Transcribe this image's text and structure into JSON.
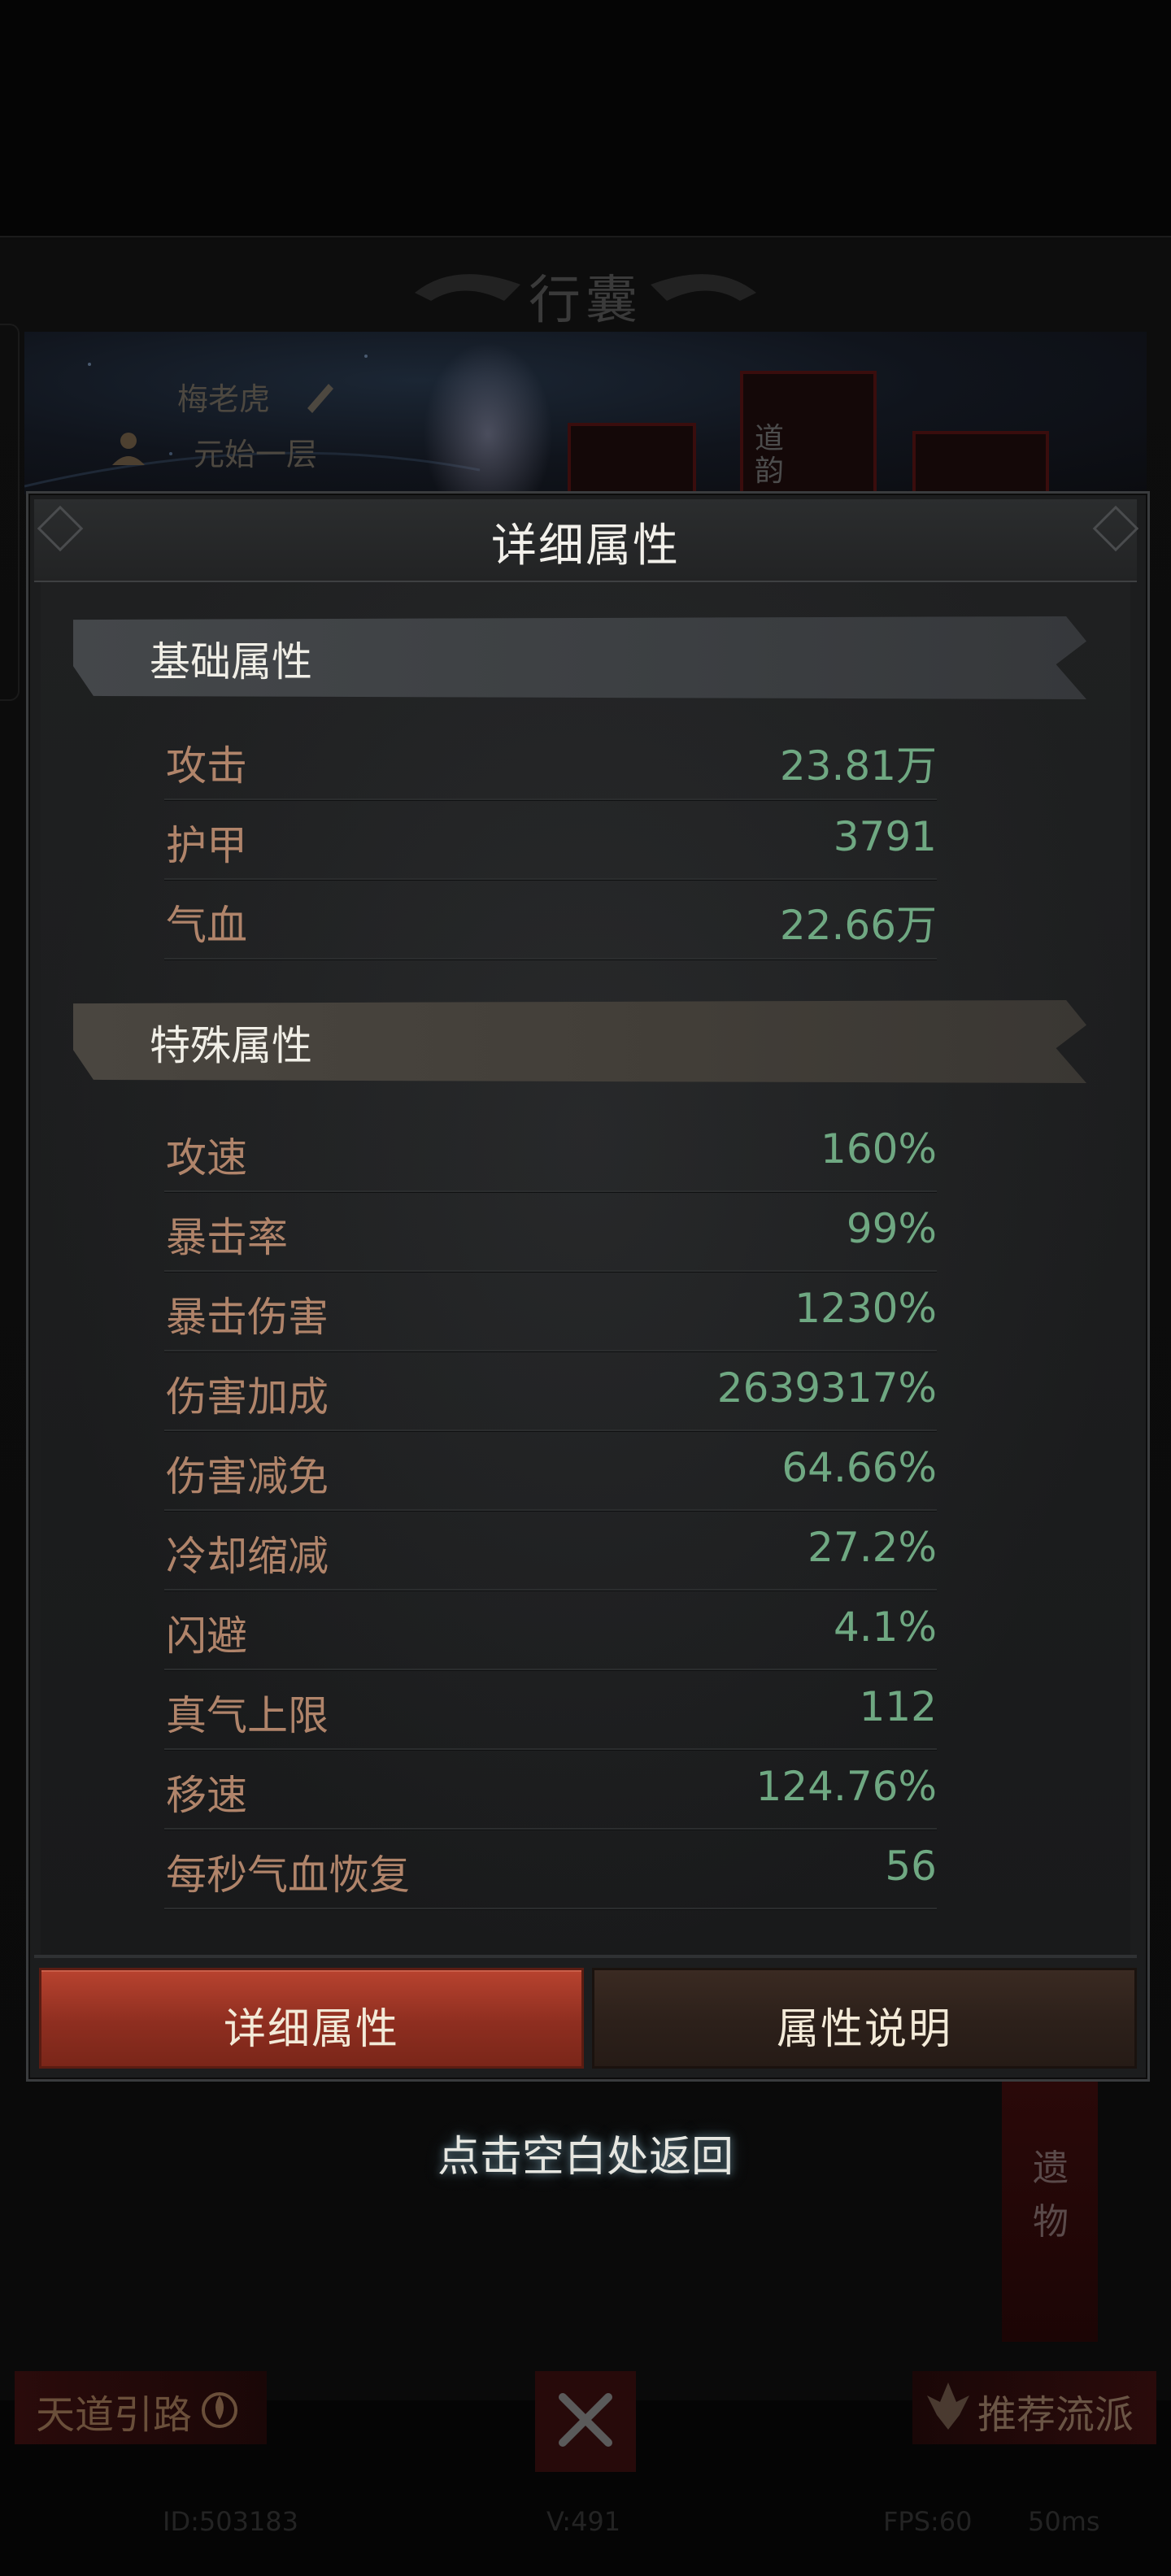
{
  "background": {
    "bag_title": "行囊",
    "hero_name": "梅老虎",
    "hero_realm": "元始一层",
    "equip_slot_text": "道\n韵",
    "tap_hint": "点击空白处返回",
    "relic_label": "遗\n物",
    "left_button": "天道引路",
    "right_button": "推荐流派",
    "footer": {
      "id_text": "ID:503183",
      "version_text": "V:491",
      "fps_text": "FPS:60",
      "latency_text": "50ms"
    }
  },
  "modal": {
    "title": "详细属性",
    "sections": [
      {
        "title": "基础属性",
        "rows": [
          {
            "label": "攻击",
            "value": "23.81万"
          },
          {
            "label": "护甲",
            "value": "3791"
          },
          {
            "label": "气血",
            "value": "22.66万"
          }
        ]
      },
      {
        "title": "特殊属性",
        "rows": [
          {
            "label": "攻速",
            "value": "160%"
          },
          {
            "label": "暴击率",
            "value": "99%"
          },
          {
            "label": "暴击伤害",
            "value": "1230%"
          },
          {
            "label": "伤害加成",
            "value": "2639317%"
          },
          {
            "label": "伤害减免",
            "value": "64.66%"
          },
          {
            "label": "冷却缩减",
            "value": "27.2%"
          },
          {
            "label": "闪避",
            "value": "4.1%"
          },
          {
            "label": "真气上限",
            "value": "112"
          },
          {
            "label": "移速",
            "value": "124.76%"
          },
          {
            "label": "每秒气血恢复",
            "value": "56"
          }
        ]
      }
    ],
    "tabs": [
      {
        "label": "详细属性",
        "active": true
      },
      {
        "label": "属性说明",
        "active": false
      }
    ]
  },
  "colors": {
    "label": "#b0846a",
    "value": "#6fa882",
    "active_tab": "#b8432f",
    "inactive_tab": "#3a2a22"
  },
  "icons": [
    "pen-icon",
    "realm-emblem-icon",
    "tiandao-flame-icon",
    "crossed-swords-icon",
    "recommend-emblem-icon"
  ]
}
